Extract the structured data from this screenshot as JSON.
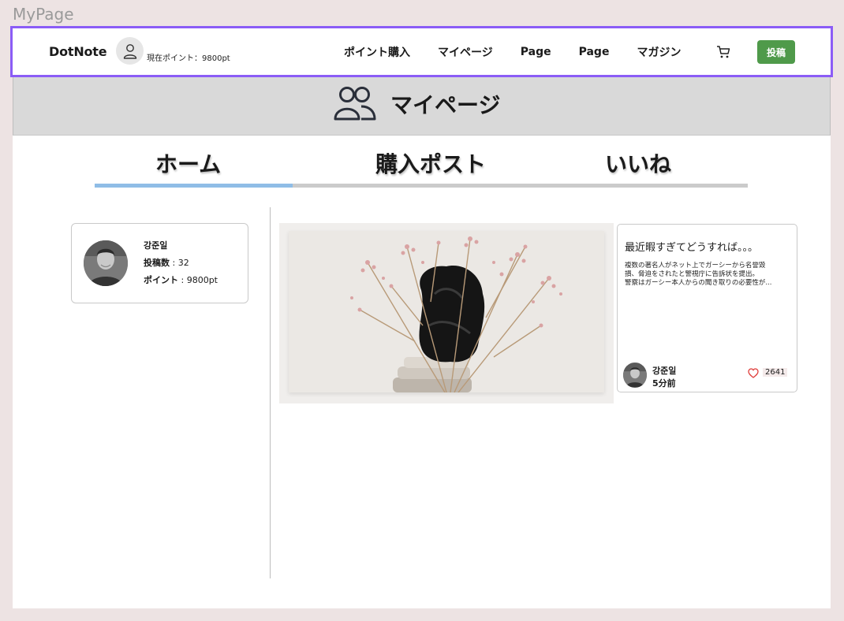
{
  "frame": {
    "label": "MyPage"
  },
  "navbar": {
    "logo": "DotNote",
    "points_text": "現在ポイント：9800pt",
    "links": [
      "ポイント購入",
      "マイページ",
      "Page",
      "Page",
      "マガジン"
    ],
    "post_button": "投稿",
    "accent_color": "#8b5cf6",
    "post_button_color": "#4f9a4a"
  },
  "header": {
    "title": "マイページ",
    "icon": "users-icon"
  },
  "tabs": {
    "items": [
      "ホーム",
      "購入ポスト",
      "いいね"
    ],
    "active": "ホーム",
    "indicator_color": "#8fbde6"
  },
  "profile": {
    "name": "강준일",
    "posts_label": "投稿数",
    "posts_value": " : 32",
    "points_label": "ポイント",
    "points_value": " : 9800pt"
  },
  "post": {
    "title": "最近暇すぎてどうすれば。。。",
    "body_lines": [
      "複数の著名人がネット上でガーシーから名誉毀",
      "損、脅迫をされたと警視庁に告訴状を提出。",
      "警察はガーシー本人からの聞き取りの必要性が..."
    ],
    "author": "강준일",
    "time": "5分前",
    "likes": "2641"
  }
}
